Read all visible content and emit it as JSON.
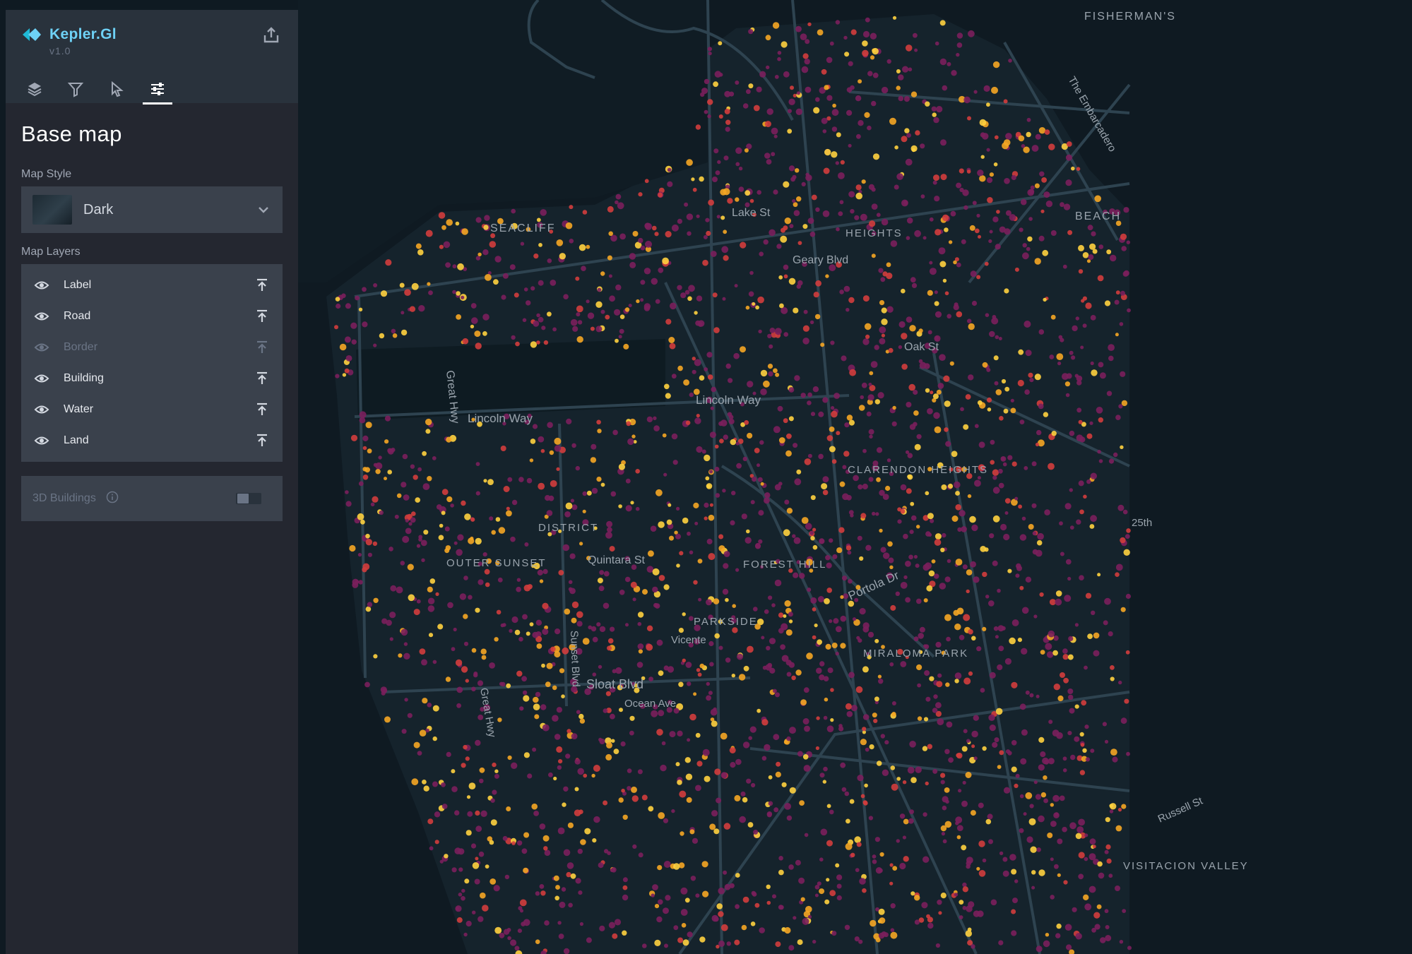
{
  "app": {
    "name": "Kepler.Gl",
    "version": "v1.0"
  },
  "tabs": [
    {
      "icon": "layers-icon"
    },
    {
      "icon": "filter-icon"
    },
    {
      "icon": "interaction-cursor-icon"
    },
    {
      "icon": "map-settings-sliders-icon",
      "active": true
    }
  ],
  "panel": {
    "title": "Base map",
    "map_style_label": "Map Style",
    "map_style_value": "Dark",
    "map_layers_label": "Map Layers",
    "layers": [
      {
        "label": "Label",
        "visible": true
      },
      {
        "label": "Road",
        "visible": true
      },
      {
        "label": "Border",
        "visible": false
      },
      {
        "label": "Building",
        "visible": true
      },
      {
        "label": "Water",
        "visible": true
      },
      {
        "label": "Land",
        "visible": true
      }
    ],
    "buildings_3d_label": "3D Buildings",
    "buildings_3d_enabled": false
  },
  "map": {
    "labels": {
      "fishermans": "FISHERMAN'S",
      "seacliff": "SEACLIFF",
      "lake_st": "Lake St",
      "heights": "HEIGHTS",
      "geary": "Geary Blvd",
      "oak_st": "Oak St",
      "great_hwy": "Great Hwy",
      "great_hwy_2": "Great Hwy",
      "lincoln_way_left": "Lincoln Way",
      "lincoln_way_center": "Lincoln Way",
      "clarendon_heights": "CLARENDON HEIGHTS",
      "outer_sunset": "OUTER SUNSET",
      "district": "DISTRICT",
      "quintara": "Quintara St",
      "forest_hill": "FOREST HILL",
      "portola": "Portola Dr",
      "parkside": "PARKSIDE",
      "vicente": "Vicente",
      "miraloma_park": "MIRALOMA PARK",
      "sloat": "Sloat Blvd",
      "ocean_ave": "Ocean Ave",
      "sunset_blvd": "Sunset Blvd",
      "beach": "BEACH",
      "embarcadero": "The Embarcadero",
      "visitacion_valley": "VISITACION VALLEY",
      "russell_st": "Russell St",
      "st_25": "25th"
    },
    "colors": {
      "background": "#0f1a22",
      "land": "#15232c",
      "water": "#0b141b",
      "road": "#2e4350",
      "point_low": "#7a1f5c",
      "point_mid": "#d13d3d",
      "point_high": "#f5a623",
      "point_top": "#ffd23f"
    }
  }
}
